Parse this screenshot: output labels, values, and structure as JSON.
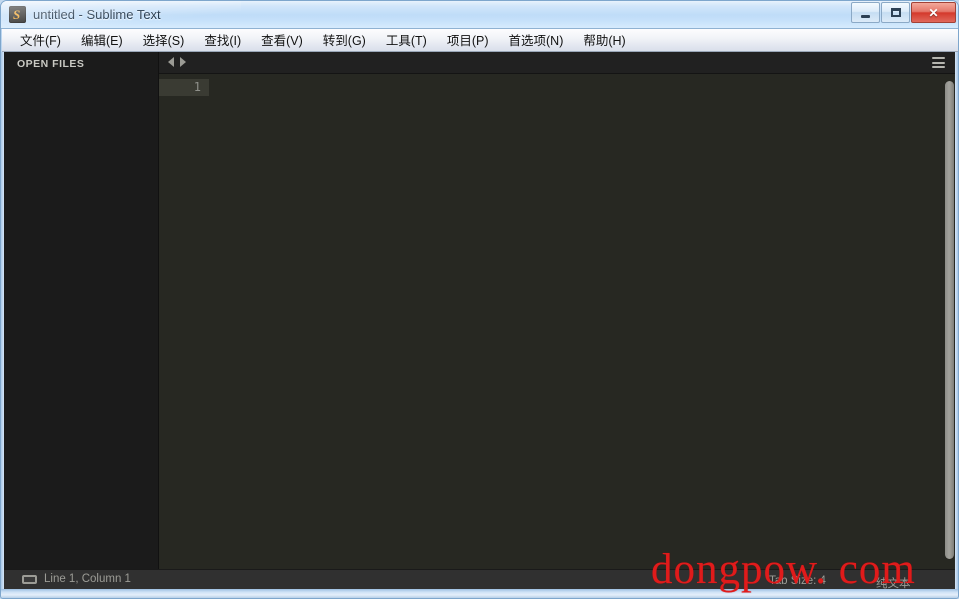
{
  "window": {
    "title": "untitled - Sublime Text",
    "app_icon": "sublime-text-icon",
    "icon_glyph": "S",
    "buttons": {
      "minimize_label": "Minimize",
      "maximize_label": "Maximize",
      "close_label": "✕"
    }
  },
  "menu": {
    "items": [
      {
        "label": "文件(F)"
      },
      {
        "label": "编辑(E)"
      },
      {
        "label": "选择(S)"
      },
      {
        "label": "查找(I)"
      },
      {
        "label": "查看(V)"
      },
      {
        "label": "转到(G)"
      },
      {
        "label": "工具(T)"
      },
      {
        "label": "项目(P)"
      },
      {
        "label": "首选项(N)"
      },
      {
        "label": "帮助(H)"
      }
    ]
  },
  "sidebar": {
    "header": "OPEN FILES",
    "items": []
  },
  "tab_bar": {
    "prev_icon": "chevron-left-icon",
    "next_icon": "chevron-right-icon",
    "menu_icon": "hamburger-menu-icon"
  },
  "editor": {
    "line_numbers": [
      "1"
    ],
    "content": "",
    "active_line": "1"
  },
  "status_bar": {
    "position_icon": "encoding-icon",
    "position": "Line 1, Column 1",
    "tab_size": "Tab Size: 4",
    "syntax": "纯文本"
  },
  "watermark": {
    "text": "dongpow. com",
    "color": "#e01b1b"
  },
  "colors": {
    "editor_background": "#272822",
    "sidebar_background": "#1b1b1b",
    "status_background": "#303030",
    "accent": "#f0a021",
    "titlebar": "#bfdcf8"
  }
}
